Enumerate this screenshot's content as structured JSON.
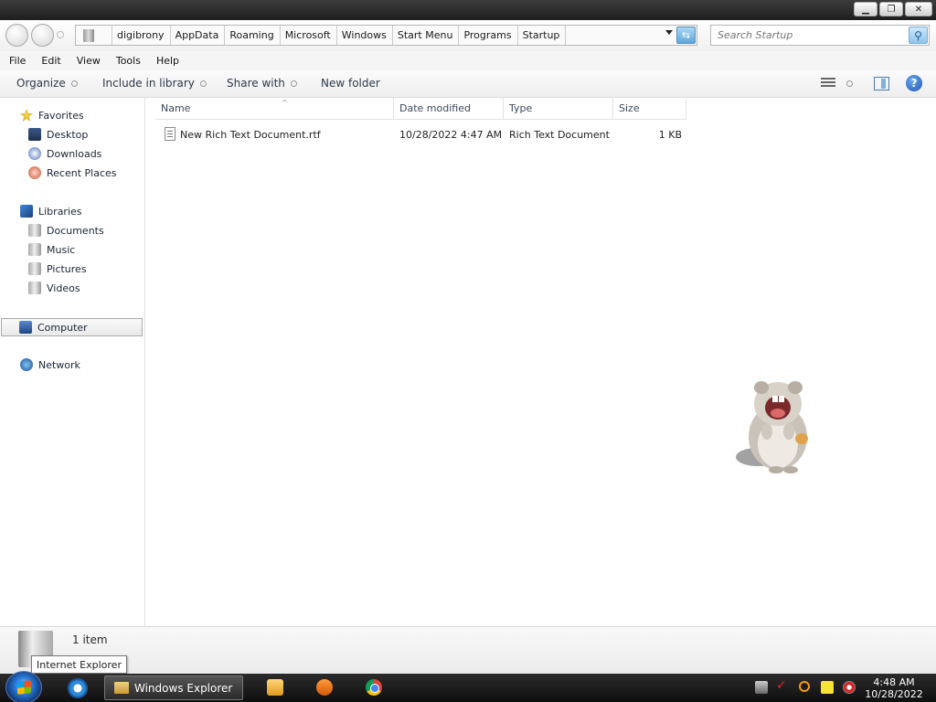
{
  "titlebar": {
    "minimize": "▁",
    "maximize": "❐",
    "close": "✕"
  },
  "nav": {
    "back_label": "",
    "forward_label": ""
  },
  "address": {
    "crumbs": [
      "digibrony",
      "AppData",
      "Roaming",
      "Microsoft",
      "Windows",
      "Start Menu",
      "Programs",
      "Startup"
    ]
  },
  "search": {
    "placeholder": "Search Startup"
  },
  "menubar": [
    "File",
    "Edit",
    "View",
    "Tools",
    "Help"
  ],
  "commands": {
    "organize": "Organize",
    "include_library": "Include in library",
    "share_with": "Share with",
    "new_folder": "New folder"
  },
  "sidebar": {
    "favorites": "Favorites",
    "desktop": "Desktop",
    "downloads": "Downloads",
    "recent_places": "Recent Places",
    "libraries": "Libraries",
    "documents": "Documents",
    "music": "Music",
    "pictures": "Pictures",
    "videos": "Videos",
    "computer": "Computer",
    "network": "Network"
  },
  "columns": {
    "name": "Name",
    "date": "Date modified",
    "type": "Type",
    "size": "Size"
  },
  "files": [
    {
      "name": "New Rich Text Document.rtf",
      "date": "10/28/2022 4:47 AM",
      "type": "Rich Text Document",
      "size": "1 KB"
    }
  ],
  "details": {
    "count": "1 item"
  },
  "tooltip": "Internet Explorer",
  "taskbar": {
    "explorer_label": "Windows Explorer",
    "time": "4:48 AM",
    "date": "10/28/2022"
  },
  "icons": {
    "back": "back-arrow-icon",
    "forward": "forward-arrow-icon",
    "refresh": "refresh-icon",
    "search": "search-icon",
    "help": "help-icon",
    "views": "views-icon",
    "preview_pane": "preview-pane-icon"
  }
}
